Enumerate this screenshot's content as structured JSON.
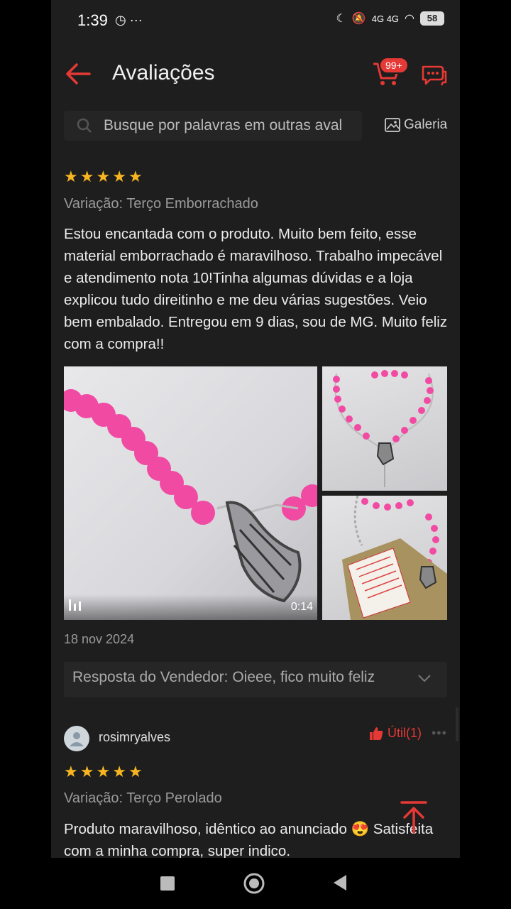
{
  "status_bar": {
    "time": "1:39",
    "left_icons": "◷ ···",
    "network_labels": "4G 4G",
    "battery": "58"
  },
  "header": {
    "title": "Avaliações",
    "cart_badge": "99+"
  },
  "search": {
    "placeholder": "Busque por palavras em outras aval",
    "gallery_label": "Galeria"
  },
  "review1": {
    "stars": 5,
    "variation": "Variação: Terço Emborrachado",
    "text": "Estou encantada com o produto. Muito bem feito, esse material emborrachado é maravilhoso. Trabalho impecável e atendimento nota 10!Tinha algumas dúvidas e a loja explicou tudo direitinho e me deu várias sugestões. Veio bem embalado. Entregou em 9 dias, sou de MG. Muito feliz com a compra!!",
    "video_duration": "0:14",
    "date": "18 nov 2024",
    "seller_reply": "Resposta do Vendedor: Oieee, fico muito feliz"
  },
  "review2": {
    "username": "rosimryalves",
    "useful_label": "Útil(1)",
    "stars": 5,
    "variation": "Variação: Terço Perolado",
    "text": "Produto maravilhoso, idêntico ao anunciado 😍 Satisfeita com a minha compra, super indico."
  },
  "colors": {
    "accent": "#e53935",
    "star": "#f7b521",
    "background": "#1e1e1e"
  }
}
